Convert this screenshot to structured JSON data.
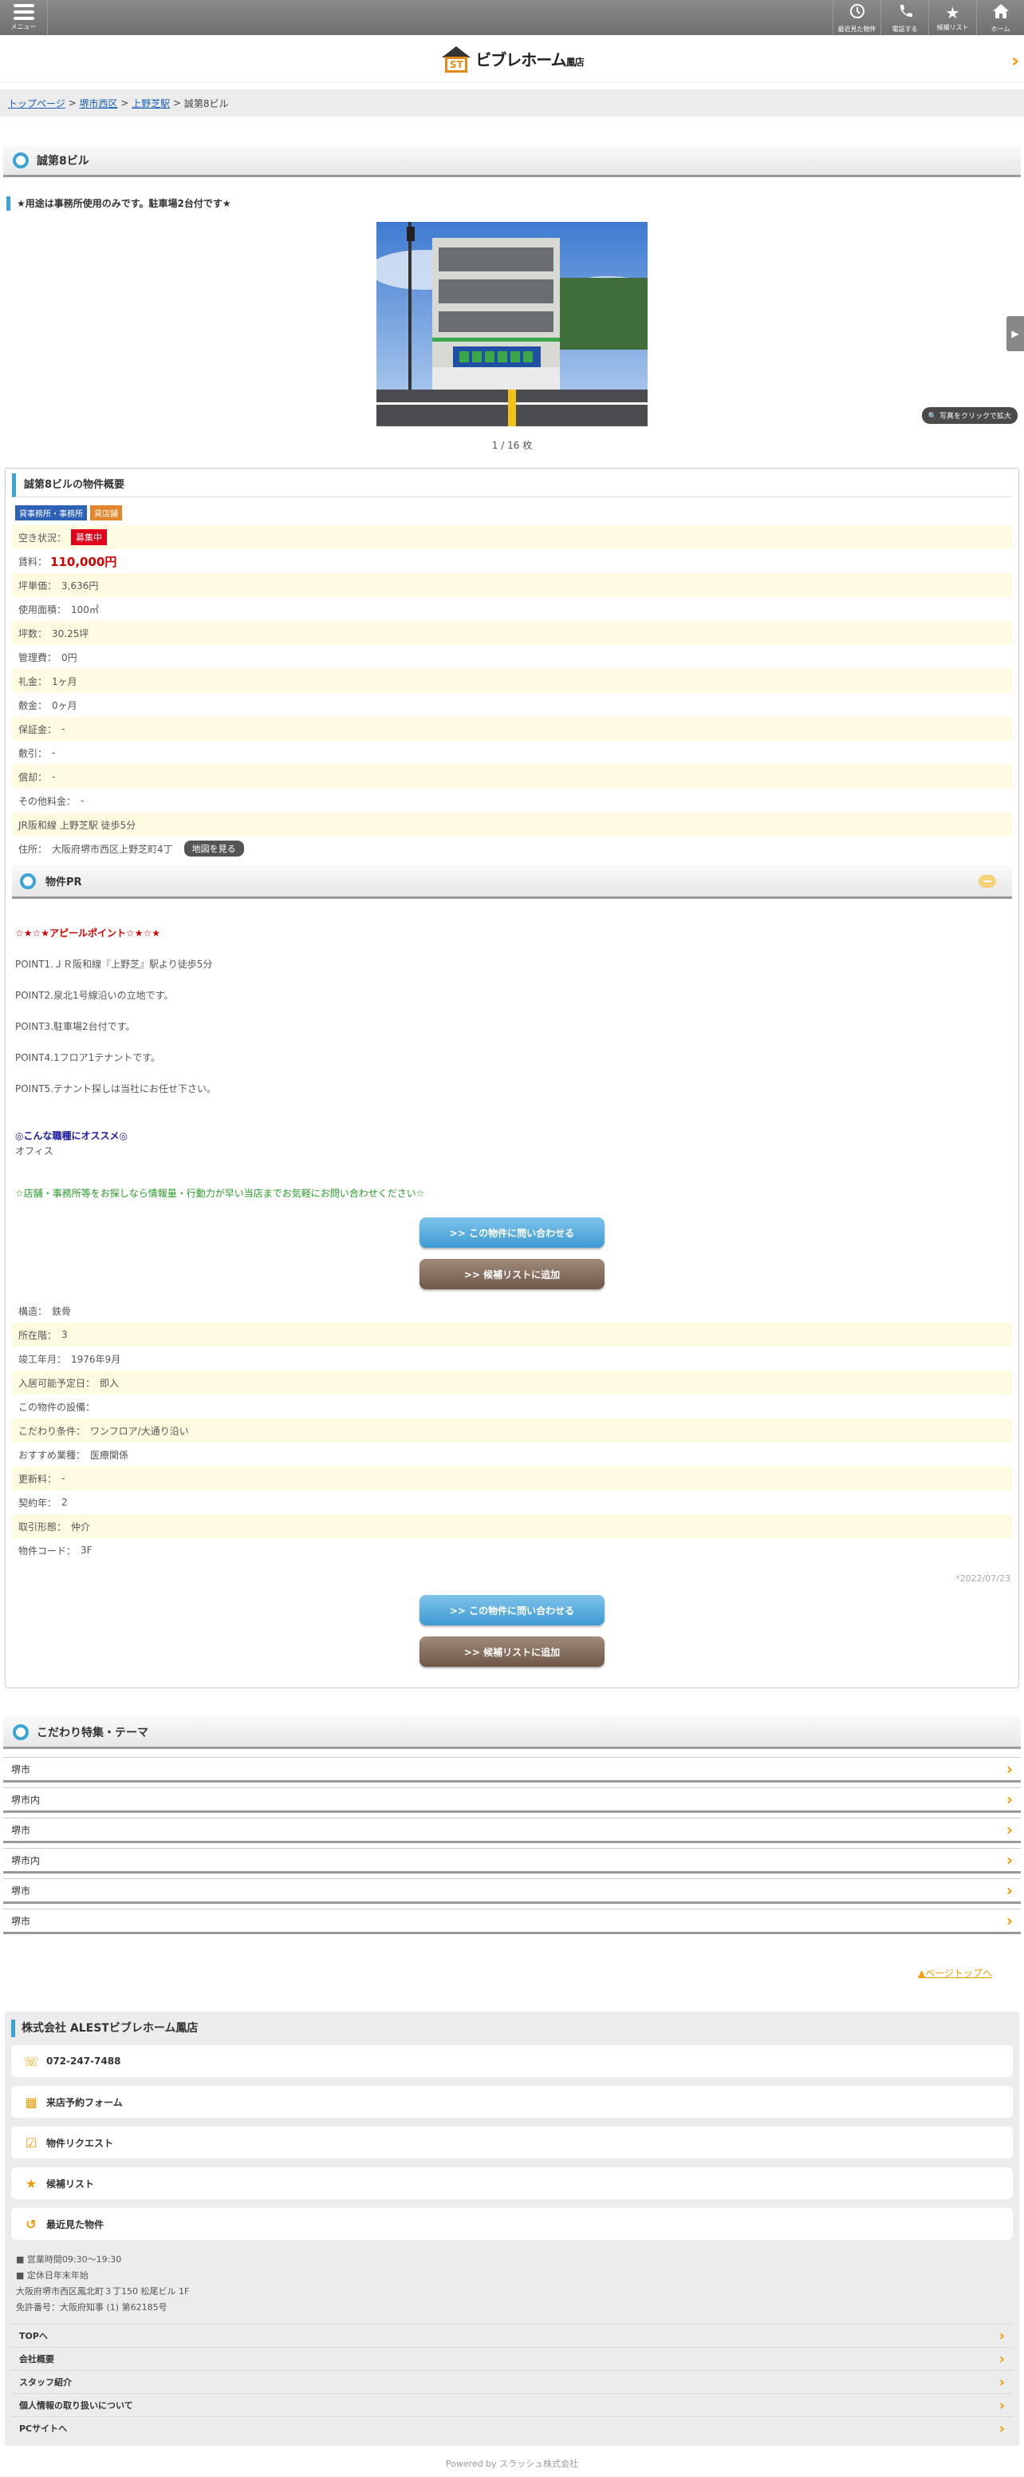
{
  "header": {
    "menu_label": "メニュー",
    "buttons": [
      {
        "label": "最近見た物件",
        "icon": "history-icon"
      },
      {
        "label": "電話する",
        "icon": "phone-icon"
      },
      {
        "label": "候補リスト",
        "icon": "star-icon"
      },
      {
        "label": "ホーム",
        "icon": "home-icon"
      }
    ],
    "logo_text": "ビブレホーム",
    "logo_suffix": "鳳店",
    "logo_mark": "ST"
  },
  "breadcrumb": {
    "top": "トップページ",
    "area": "堺市西区",
    "station": "上野芝駅",
    "current": "誠第8ビル"
  },
  "property": {
    "title": "誠第8ビル",
    "notice": "★用途は事務所使用のみです。駐車場2台付です★",
    "photo_counter": "1 / 16 枚",
    "zoom_label": "写真をクリックで拡大",
    "summary_title": "誠第8ビルの物件概要",
    "tags": [
      "貸事務所・事務所",
      "貸店舗"
    ],
    "status_label": "空き状況：",
    "status_value": "募集中",
    "rent_label": "賃料：",
    "rent_value": "110,000円",
    "rows": [
      {
        "label": "坪単価：",
        "value": "3,636円"
      },
      {
        "label": "使用面積：",
        "value": "100㎡"
      },
      {
        "label": "坪数：",
        "value": "30.25坪"
      },
      {
        "label": "管理費：",
        "value": "0円"
      },
      {
        "label": "礼金：",
        "value": "1ヶ月"
      },
      {
        "label": "敷金：",
        "value": "0ヶ月"
      },
      {
        "label": "保証金：",
        "value": "-"
      },
      {
        "label": "敷引：",
        "value": "-"
      },
      {
        "label": "償却：",
        "value": "-"
      },
      {
        "label": "その他料金：",
        "value": "-"
      }
    ],
    "access": "JR阪和線 上野芝駅 徒歩5分",
    "address_label": "住所：",
    "address_value": "大阪府堺市西区上野芝町4丁",
    "map_button": "地図を見る"
  },
  "pr": {
    "heading": "物件PR",
    "appeal": "☆★☆★アピールポイント☆★☆★",
    "points": [
      "POINT1.ＪＲ阪和線『上野芝』駅より徒歩5分",
      "POINT2.泉北1号線沿いの立地です。",
      "POINT3.駐車場2台付です。",
      "POINT4.1フロア1テナントです。",
      "POINT5.テナント探しは当社にお任せ下さい。"
    ],
    "suit_heading": "◎こんな職種にオススメ◎",
    "suit_value": "オフィス",
    "closing": "☆店舗・事務所等をお探しなら情報量・行動力が早い当店までお気軽にお問い合わせください☆"
  },
  "cta": {
    "inquiry": ">> この物件に問い合わせる",
    "add_list": ">> 候補リストに追加"
  },
  "details": [
    {
      "label": "構造：",
      "value": "鉄骨"
    },
    {
      "label": "所在階：",
      "value": "3"
    },
    {
      "label": "竣工年月：",
      "value": "1976年9月"
    },
    {
      "label": "入居可能予定日：",
      "value": "即入"
    },
    {
      "label": "この物件の設備：",
      "value": ""
    },
    {
      "label": "こだわり条件：",
      "value": "ワンフロア/大通り沿い"
    },
    {
      "label": "おすすめ業種：",
      "value": "医療関係"
    },
    {
      "label": "更新料：",
      "value": "-"
    },
    {
      "label": "契約年：",
      "value": "2"
    },
    {
      "label": "取引形態：",
      "value": "仲介"
    },
    {
      "label": "物件コード：",
      "value": "3F"
    }
  ],
  "updated": "*2022/07/23",
  "features": {
    "heading": "こだわり特集・テーマ",
    "items": [
      "堺市",
      "堺市内",
      "堺市",
      "堺市内",
      "堺市",
      "堺市"
    ]
  },
  "pagetop": "▲ページトップへ",
  "footer": {
    "company": "株式会社 ALESTビブレホーム鳳店",
    "buttons": [
      {
        "label": "072-247-7488",
        "icon": "phone-icon"
      },
      {
        "label": "来店予約フォーム",
        "icon": "shop-icon"
      },
      {
        "label": "物件リクエスト",
        "icon": "request-icon"
      },
      {
        "label": "候補リスト",
        "icon": "star-icon"
      },
      {
        "label": "最近見た物件",
        "icon": "history-icon"
      }
    ],
    "info": [
      "■ 営業時間09:30〜19:30",
      "■ 定休日年末年始",
      "大阪府堺市西区鳳北町３丁150 松尾ビル 1F",
      "免許番号：大阪府知事 (1) 第62185号"
    ],
    "links": [
      "TOPへ",
      "会社概要",
      "スタッフ紹介",
      "個人情報の取り扱いについて",
      "PCサイトへ"
    ],
    "powered": "Powered by スラッシュ株式会社"
  }
}
